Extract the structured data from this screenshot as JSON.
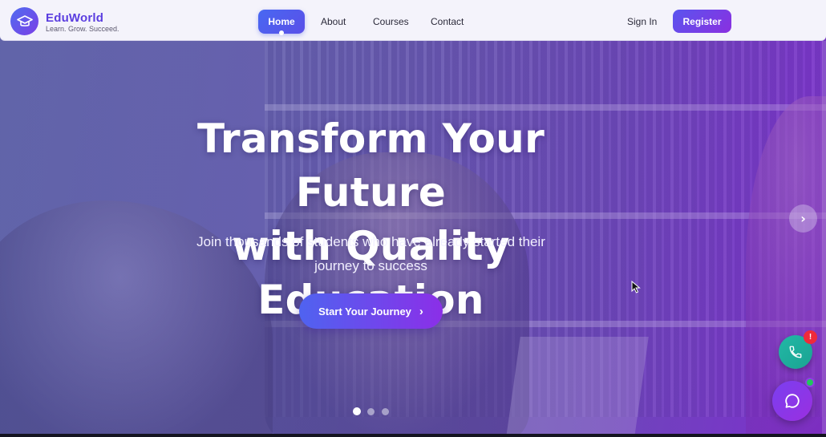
{
  "brand": {
    "name": "EduWorld",
    "tagline": "Learn. Grow. Succeed."
  },
  "nav": {
    "items": [
      {
        "label": "Home",
        "active": true
      },
      {
        "label": "About"
      },
      {
        "label": "Courses"
      },
      {
        "label": "Contact"
      }
    ],
    "signin_label": "Sign In",
    "register_label": "Register"
  },
  "hero": {
    "headline_line1": "Transform Your Future",
    "headline_line2": "with Quality Education",
    "subline_line1": "Join thousands of students who have already started their",
    "subline_line2": "journey to success",
    "cta_label": "Start Your Journey",
    "cta_icon": "chevron-right-icon",
    "slides_total": 3,
    "active_slide": 1
  },
  "floating": {
    "call_icon": "phone-icon",
    "call_badge": "!",
    "chat_icon": "chat-icon"
  },
  "colors": {
    "brand_primary": "#5b3ee0",
    "button_gradient_start": "#4f63f0",
    "button_gradient_end": "#8b2fe8",
    "call_green": "#22b8a6",
    "badge_red": "#ef2a3a",
    "online_green": "#22c55e"
  }
}
